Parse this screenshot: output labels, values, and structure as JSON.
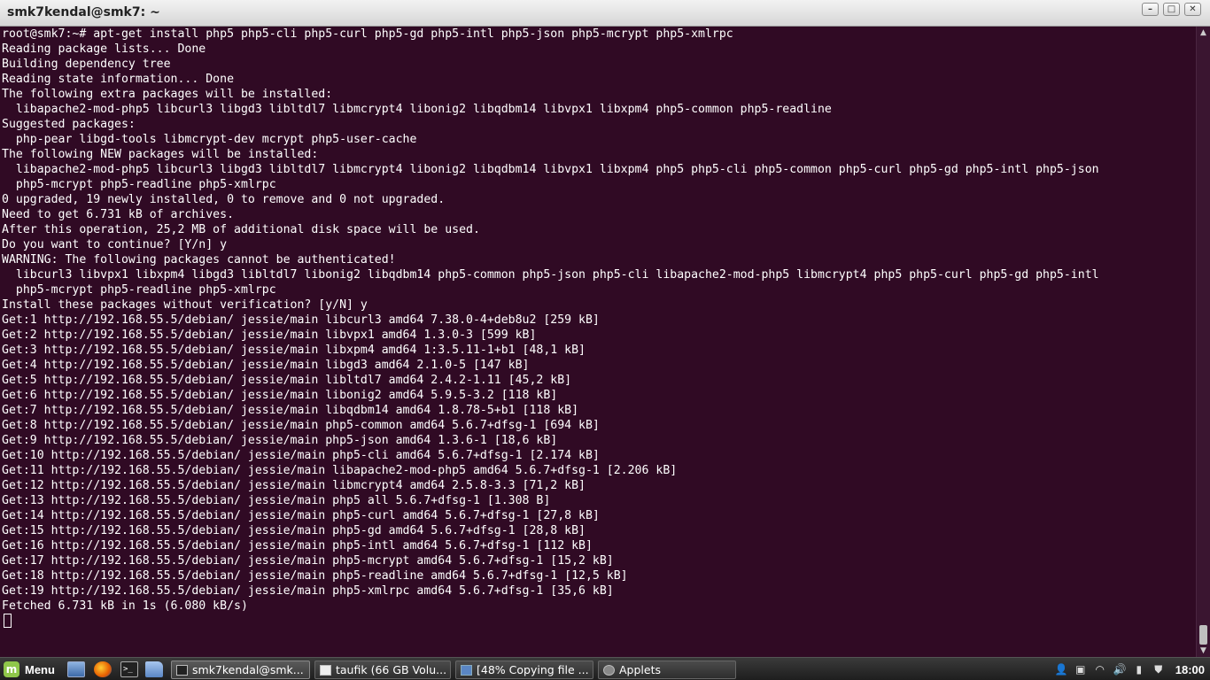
{
  "window": {
    "title": "smk7kendal@smk7: ~",
    "buttons": {
      "minimize": "–",
      "maximize": "□",
      "close": "✕"
    }
  },
  "terminal": {
    "lines": [
      "root@smk7:~# apt-get install php5 php5-cli php5-curl php5-gd php5-intl php5-json php5-mcrypt php5-xmlrpc",
      "Reading package lists... Done",
      "Building dependency tree",
      "Reading state information... Done",
      "The following extra packages will be installed:",
      "  libapache2-mod-php5 libcurl3 libgd3 libltdl7 libmcrypt4 libonig2 libqdbm14 libvpx1 libxpm4 php5-common php5-readline",
      "Suggested packages:",
      "  php-pear libgd-tools libmcrypt-dev mcrypt php5-user-cache",
      "The following NEW packages will be installed:",
      "  libapache2-mod-php5 libcurl3 libgd3 libltdl7 libmcrypt4 libonig2 libqdbm14 libvpx1 libxpm4 php5 php5-cli php5-common php5-curl php5-gd php5-intl php5-json",
      "  php5-mcrypt php5-readline php5-xmlrpc",
      "0 upgraded, 19 newly installed, 0 to remove and 0 not upgraded.",
      "Need to get 6.731 kB of archives.",
      "After this operation, 25,2 MB of additional disk space will be used.",
      "Do you want to continue? [Y/n] y",
      "WARNING: The following packages cannot be authenticated!",
      "  libcurl3 libvpx1 libxpm4 libgd3 libltdl7 libonig2 libqdbm14 php5-common php5-json php5-cli libapache2-mod-php5 libmcrypt4 php5 php5-curl php5-gd php5-intl",
      "  php5-mcrypt php5-readline php5-xmlrpc",
      "Install these packages without verification? [y/N] y",
      "Get:1 http://192.168.55.5/debian/ jessie/main libcurl3 amd64 7.38.0-4+deb8u2 [259 kB]",
      "Get:2 http://192.168.55.5/debian/ jessie/main libvpx1 amd64 1.3.0-3 [599 kB]",
      "Get:3 http://192.168.55.5/debian/ jessie/main libxpm4 amd64 1:3.5.11-1+b1 [48,1 kB]",
      "Get:4 http://192.168.55.5/debian/ jessie/main libgd3 amd64 2.1.0-5 [147 kB]",
      "Get:5 http://192.168.55.5/debian/ jessie/main libltdl7 amd64 2.4.2-1.11 [45,2 kB]",
      "Get:6 http://192.168.55.5/debian/ jessie/main libonig2 amd64 5.9.5-3.2 [118 kB]",
      "Get:7 http://192.168.55.5/debian/ jessie/main libqdbm14 amd64 1.8.78-5+b1 [118 kB]",
      "Get:8 http://192.168.55.5/debian/ jessie/main php5-common amd64 5.6.7+dfsg-1 [694 kB]",
      "Get:9 http://192.168.55.5/debian/ jessie/main php5-json amd64 1.3.6-1 [18,6 kB]",
      "Get:10 http://192.168.55.5/debian/ jessie/main php5-cli amd64 5.6.7+dfsg-1 [2.174 kB]",
      "Get:11 http://192.168.55.5/debian/ jessie/main libapache2-mod-php5 amd64 5.6.7+dfsg-1 [2.206 kB]",
      "Get:12 http://192.168.55.5/debian/ jessie/main libmcrypt4 amd64 2.5.8-3.3 [71,2 kB]",
      "Get:13 http://192.168.55.5/debian/ jessie/main php5 all 5.6.7+dfsg-1 [1.308 B]",
      "Get:14 http://192.168.55.5/debian/ jessie/main php5-curl amd64 5.6.7+dfsg-1 [27,8 kB]",
      "Get:15 http://192.168.55.5/debian/ jessie/main php5-gd amd64 5.6.7+dfsg-1 [28,8 kB]",
      "Get:16 http://192.168.55.5/debian/ jessie/main php5-intl amd64 5.6.7+dfsg-1 [112 kB]",
      "Get:17 http://192.168.55.5/debian/ jessie/main php5-mcrypt amd64 5.6.7+dfsg-1 [15,2 kB]",
      "Get:18 http://192.168.55.5/debian/ jessie/main php5-readline amd64 5.6.7+dfsg-1 [12,5 kB]",
      "Get:19 http://192.168.55.5/debian/ jessie/main php5-xmlrpc amd64 5.6.7+dfsg-1 [35,6 kB]",
      "Fetched 6.731 kB in 1s (6.080 kB/s)"
    ]
  },
  "taskbar": {
    "menu_label": "Menu",
    "tasks": {
      "terminal": "smk7kendal@smk...",
      "taufik": "taufik (66 GB Volu...",
      "copy": "[48% Copying file ...",
      "applets": "Applets"
    },
    "clock": "18:00"
  },
  "colors": {
    "terminal_bg": "#300a24",
    "terminal_fg": "#ffffff",
    "mint_green": "#8fc74a"
  },
  "icons": [
    "mint-menu-icon",
    "show-desktop-icon",
    "firefox-icon",
    "terminal-icon",
    "files-icon",
    "user-icon",
    "network-icon",
    "wifi-icon",
    "volume-icon",
    "battery-icon",
    "shield-icon"
  ]
}
